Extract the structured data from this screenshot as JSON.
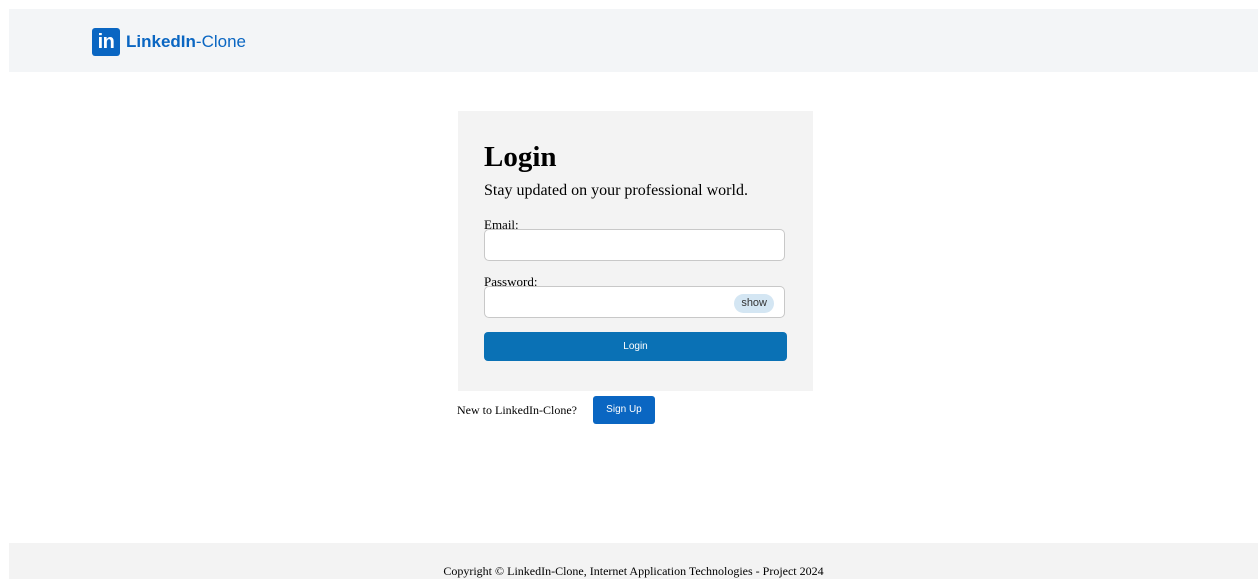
{
  "header": {
    "logo_badge": "in",
    "logo_name": "LinkedIn",
    "logo_suffix": "-Clone"
  },
  "login_card": {
    "title": "Login",
    "subtitle": "Stay updated on your professional world.",
    "email_label": "Email:",
    "email_value": "",
    "password_label": "Password:",
    "password_value": "",
    "show_label": "show",
    "login_button": "Login"
  },
  "signup": {
    "prompt": "New to LinkedIn-Clone?",
    "button": "Sign Up"
  },
  "footer": {
    "copyright": "Copyright © LinkedIn-Clone, Internet Application Technologies - Project 2024"
  },
  "colors": {
    "brand": "#0a66c2",
    "button": "#0a71b5",
    "card_bg": "#f3f3f3",
    "show_bg": "#d4e6f3"
  }
}
